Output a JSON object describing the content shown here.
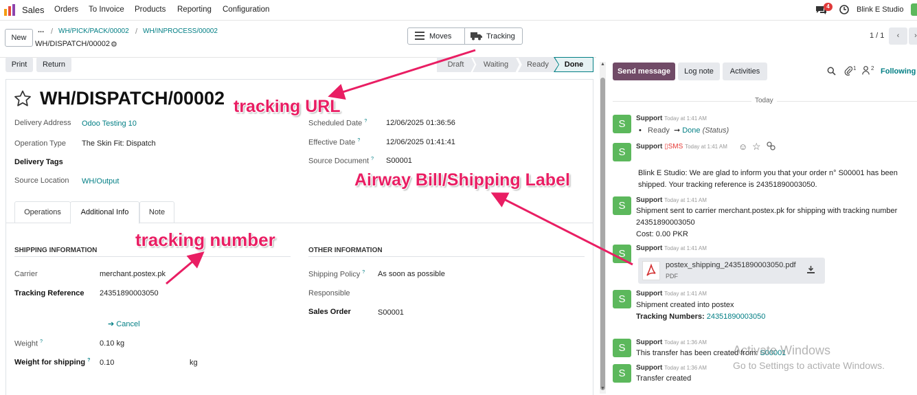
{
  "topnav": {
    "app_name": "Sales",
    "menu": [
      "Orders",
      "To Invoice",
      "Products",
      "Reporting",
      "Configuration"
    ],
    "chat_badge": "4",
    "company": "Blink E Studio"
  },
  "control": {
    "new_label": "New",
    "breadcrumb_ellipsis": "...",
    "breadcrumb": [
      "WH/PICK/PACK/00002",
      "WH/INPROCESS/00002"
    ],
    "record_name": "WH/DISPATCH/00002",
    "moves_label": "Moves",
    "tracking_label": "Tracking",
    "pager": "1 / 1"
  },
  "statusbar": {
    "print_label": "Print",
    "return_label": "Return",
    "stages": [
      "Draft",
      "Waiting",
      "Ready",
      "Done"
    ],
    "active_stage": "Done"
  },
  "form": {
    "title": "WH/DISPATCH/00002",
    "left_fields": [
      {
        "label": "Delivery Address",
        "value": "Odoo Testing 10"
      },
      {
        "label": "Operation Type",
        "value": "The Skin Fit: Dispatch"
      },
      {
        "label": "Delivery Tags",
        "value": ""
      },
      {
        "label": "Source Location",
        "value": "WH/Output"
      }
    ],
    "right_fields": [
      {
        "label": "Scheduled Date",
        "value": "12/06/2025 01:36:56"
      },
      {
        "label": "Effective Date",
        "value": "12/06/2025 01:41:41"
      },
      {
        "label": "Source Document",
        "value": "S00001"
      }
    ],
    "tabs": [
      "Operations",
      "Additional Info",
      "Note"
    ],
    "active_tab": "Additional Info",
    "shipping_header": "SHIPPING INFORMATION",
    "carrier_label": "Carrier",
    "carrier_value": "merchant.postex.pk",
    "tracking_ref_label": "Tracking Reference",
    "tracking_ref_value": "24351890003050",
    "cancel_label": "Cancel",
    "weight_label": "Weight",
    "weight_value": "0.10 kg",
    "weight_ship_label": "Weight for shipping",
    "weight_ship_value": "0.10",
    "weight_ship_unit": "kg",
    "other_header": "OTHER INFORMATION",
    "shipping_policy_label": "Shipping Policy",
    "shipping_policy_value": "As soon as possible",
    "responsible_label": "Responsible",
    "sales_order_label": "Sales Order",
    "sales_order_value": "S00001"
  },
  "chatter": {
    "send_message": "Send message",
    "log_note": "Log note",
    "activities": "Activities",
    "attachments_count": "1",
    "followers_count": "2",
    "following": "Following",
    "today": "Today",
    "messages": [
      {
        "author": "Support",
        "time": "Today at 1:41 AM",
        "ready": "Ready",
        "done": "Done",
        "status": "(Status)"
      },
      {
        "author": "Support",
        "sms": "SMS",
        "time": "Today at 1:41 AM",
        "body": "Blink E Studio: We are glad to inform you that your order n° S00001 has been shipped. Your tracking reference is 24351890003050."
      },
      {
        "author": "Support",
        "time": "Today at 1:41 AM",
        "line1": "Shipment sent to carrier merchant.postex.pk for shipping with tracking number",
        "line2": "24351890003050",
        "line3": "Cost: 0.00 PKR"
      },
      {
        "author": "Support",
        "time": "Today at 1:41 AM",
        "file_name": "postex_shipping_24351890003050.pdf",
        "file_type": "PDF"
      },
      {
        "author": "Support",
        "time": "Today at 1:41 AM",
        "line1": "Shipment created into postex",
        "tn_label": "Tracking Numbers:",
        "tn_value": "24351890003050"
      },
      {
        "author": "Support",
        "time": "Today at 1:36 AM",
        "line1": "This transfer has been created from:",
        "link": "S00001"
      },
      {
        "author": "Support",
        "time": "Today at 1:36 AM",
        "line1": "Transfer created"
      }
    ]
  },
  "watermark": {
    "line1": "Activate Windows",
    "line2": "Go to Settings to activate Windows."
  },
  "annotations": {
    "tracking_url": "tracking URL",
    "airway_bill": "Airway Bill/Shipping Label",
    "tracking_number": "tracking number"
  },
  "colors": {
    "accent": "#017e84",
    "primary": "#714b67",
    "annotation": "#e91e63",
    "avatar": "#5cb85c"
  }
}
